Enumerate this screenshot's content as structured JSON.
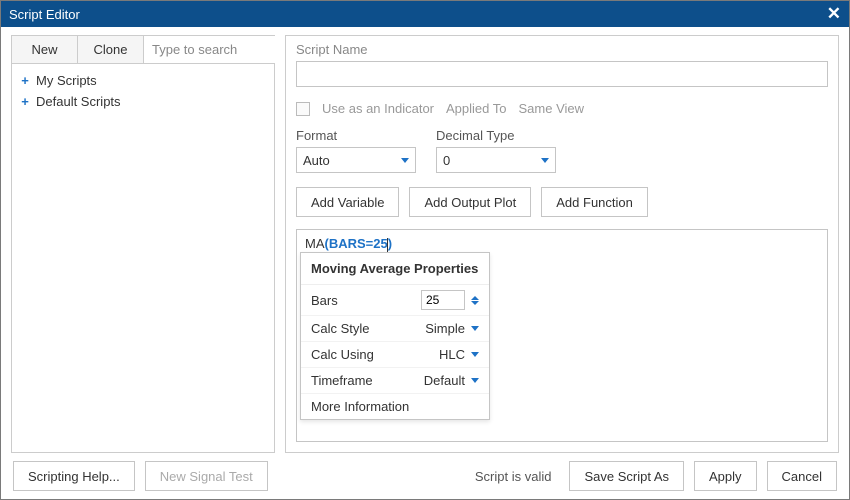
{
  "title": "Script Editor",
  "tabs": {
    "new": "New",
    "clone": "Clone"
  },
  "search_placeholder": "Type to search",
  "tree": {
    "my_scripts": "My Scripts",
    "default_scripts": "Default Scripts"
  },
  "labels": {
    "script_name": "Script Name",
    "use_as_indicator": "Use as an Indicator",
    "applied_to": "Applied To",
    "same_view": "Same View",
    "format": "Format",
    "decimal_type": "Decimal Type"
  },
  "selects": {
    "format_value": "Auto",
    "decimal_value": "0"
  },
  "buttons": {
    "add_variable": "Add Variable",
    "add_output_plot": "Add Output Plot",
    "add_function": "Add Function",
    "scripting_help": "Scripting Help...",
    "new_signal_test": "New Signal Test",
    "save_script_as": "Save Script As",
    "apply": "Apply",
    "cancel": "Cancel"
  },
  "code": {
    "fn": "MA",
    "arg_open": "(",
    "arg": "BARS=25",
    "arg_close": ")"
  },
  "popup": {
    "title": "Moving Average Properties",
    "bars_label": "Bars",
    "bars_value": "25",
    "calc_style_label": "Calc Style",
    "calc_style_value": "Simple",
    "calc_using_label": "Calc Using",
    "calc_using_value": "HLC",
    "timeframe_label": "Timeframe",
    "timeframe_value": "Default",
    "more_info": "More Information"
  },
  "status": "Script is valid"
}
